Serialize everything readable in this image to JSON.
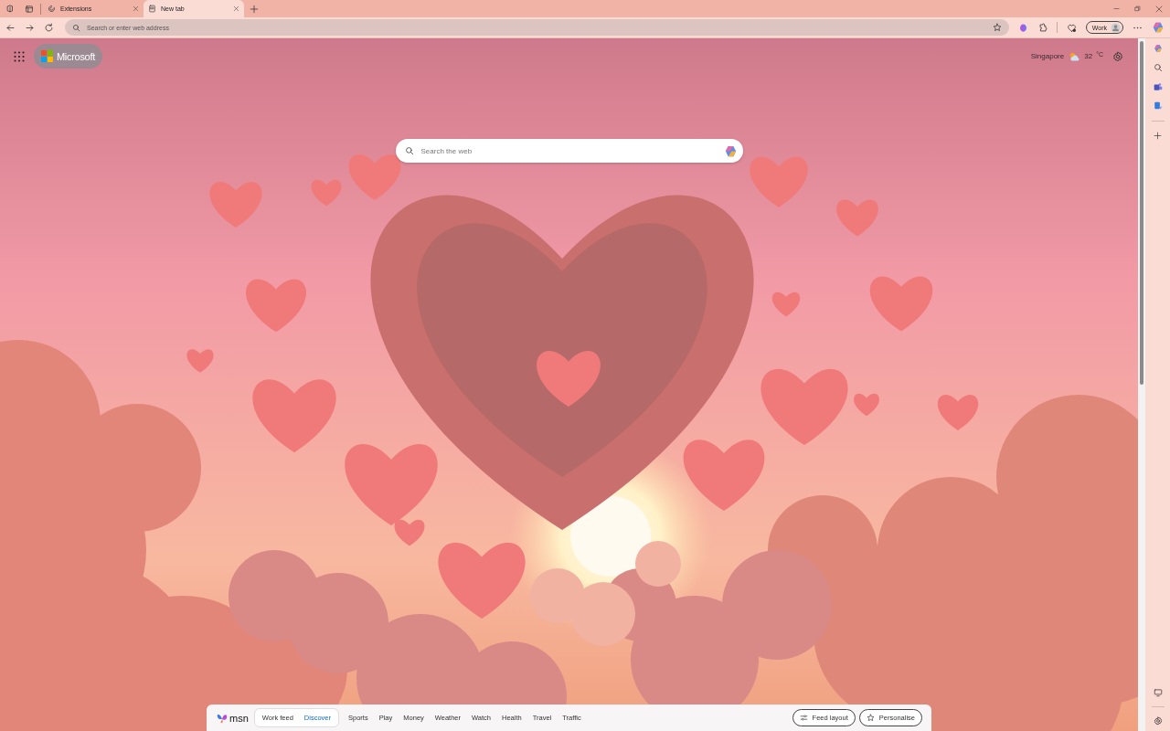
{
  "tabs": [
    {
      "title": "Extensions",
      "selected": false
    },
    {
      "title": "New tab",
      "selected": true
    }
  ],
  "address_bar": {
    "placeholder": "Search or enter web address"
  },
  "profile": {
    "label": "Work"
  },
  "page": {
    "brand": "Microsoft",
    "weather": {
      "city": "Singapore",
      "temperature": "32",
      "unit": "°C"
    },
    "search": {
      "placeholder": "Search the web"
    }
  },
  "feed_bar": {
    "logo": "msn",
    "toggle": [
      {
        "label": "Work feed",
        "selected": false
      },
      {
        "label": "Discover",
        "selected": true
      }
    ],
    "links": [
      "Sports",
      "Play",
      "Money",
      "Weather",
      "Watch",
      "Health",
      "Travel",
      "Traffic"
    ],
    "buttons": [
      "Feed layout",
      "Personalise"
    ]
  }
}
